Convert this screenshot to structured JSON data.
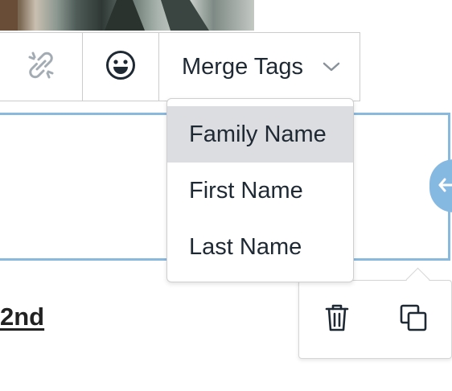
{
  "toolbar": {
    "unlink_icon": "unlink-icon",
    "emoji_icon": "emoji-icon",
    "merge_tags_label": "Merge Tags",
    "chevron_icon": "chevron-down-icon"
  },
  "merge_tags_menu": {
    "items": [
      {
        "label": "Family Name",
        "highlighted": true
      },
      {
        "label": "First Name",
        "highlighted": false
      },
      {
        "label": "Last Name",
        "highlighted": false
      }
    ]
  },
  "content": {
    "partial_text": "2nd"
  },
  "block_actions": {
    "delete_icon": "trash-icon",
    "duplicate_icon": "duplicate-icon"
  },
  "colors": {
    "selection_border": "#8ab9de",
    "handle": "#86b9e2",
    "highlight": "#dcdde0",
    "text": "#1f2933"
  }
}
